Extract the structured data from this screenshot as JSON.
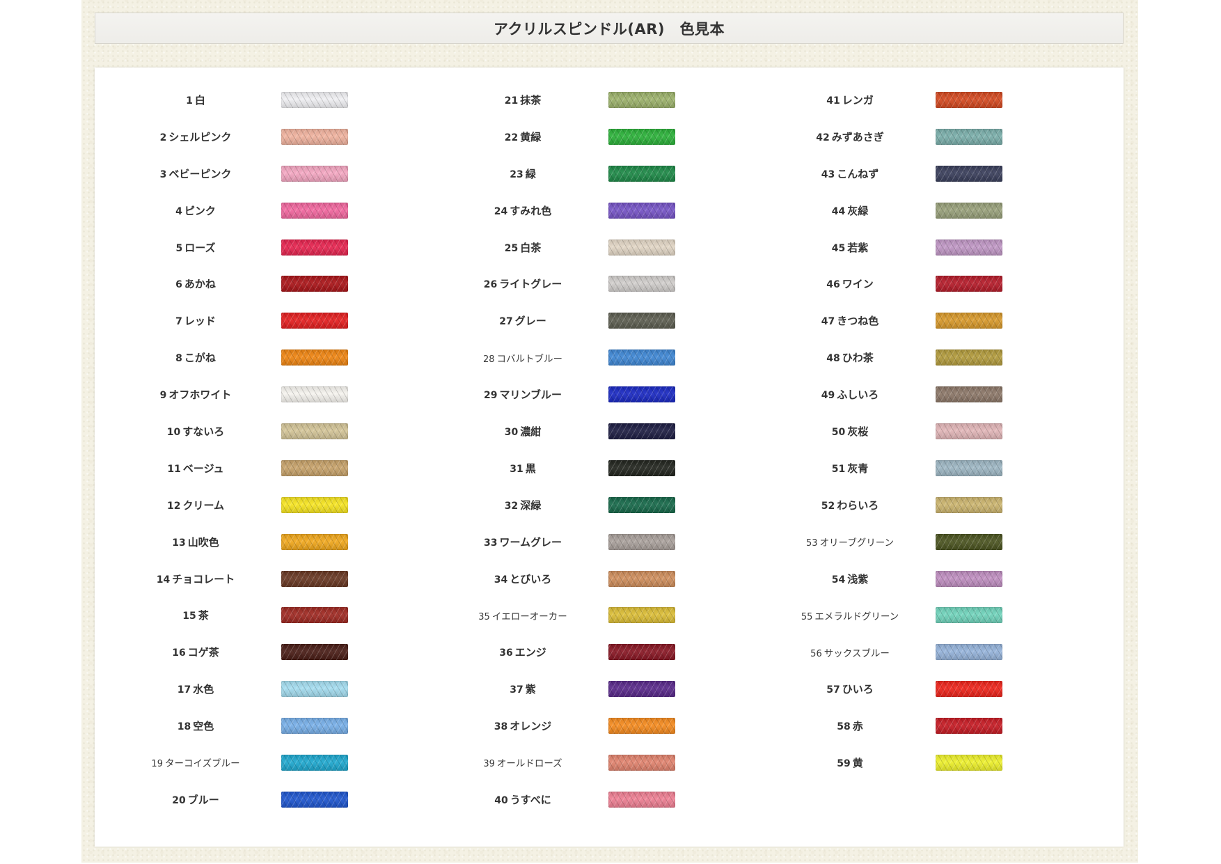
{
  "page": {
    "title": "アクリルスピンドル(AR)　色見本"
  },
  "columns": [
    {
      "items": [
        {
          "no": "1",
          "name": "白",
          "color": "#f0f0f3"
        },
        {
          "no": "2",
          "name": "シェルピンク",
          "color": "#f0b29e"
        },
        {
          "no": "3",
          "name": "ベビーピンク",
          "color": "#f4a6c1"
        },
        {
          "no": "4",
          "name": "ピンク",
          "color": "#f2679f"
        },
        {
          "no": "5",
          "name": "ローズ",
          "color": "#e72550"
        },
        {
          "no": "6",
          "name": "あかね",
          "color": "#ab1519"
        },
        {
          "no": "7",
          "name": "レッド",
          "color": "#e51f20"
        },
        {
          "no": "8",
          "name": "こがね",
          "color": "#ef8512"
        },
        {
          "no": "9",
          "name": "オフホワイト",
          "color": "#f5f3ee"
        },
        {
          "no": "10",
          "name": "すないろ",
          "color": "#d3c497"
        },
        {
          "no": "11",
          "name": "ベージュ",
          "color": "#c7a26a"
        },
        {
          "no": "12",
          "name": "クリーム",
          "color": "#f6e420"
        },
        {
          "no": "13",
          "name": "山吹色",
          "color": "#f1a81d"
        },
        {
          "no": "14",
          "name": "チョコレート",
          "color": "#6a3924"
        },
        {
          "no": "15",
          "name": "茶",
          "color": "#a02a23"
        },
        {
          "no": "16",
          "name": "コゲ茶",
          "color": "#4b1e17"
        },
        {
          "no": "17",
          "name": "水色",
          "color": "#a3dcef"
        },
        {
          "no": "18",
          "name": "空色",
          "color": "#77afe8"
        },
        {
          "no": "19",
          "name": "ターコイズブルー",
          "color": "#1ea8cf"
        },
        {
          "no": "20",
          "name": "ブルー",
          "color": "#1f56cf"
        }
      ]
    },
    {
      "items": [
        {
          "no": "21",
          "name": "抹茶",
          "color": "#9cb26b"
        },
        {
          "no": "22",
          "name": "黄緑",
          "color": "#2cb23a"
        },
        {
          "no": "23",
          "name": "緑",
          "color": "#1e8a48"
        },
        {
          "no": "24",
          "name": "すみれ色",
          "color": "#7654c6"
        },
        {
          "no": "25",
          "name": "白茶",
          "color": "#e1d5c4"
        },
        {
          "no": "26",
          "name": "ライトグレー",
          "color": "#d0cdcb"
        },
        {
          "no": "27",
          "name": "グレー",
          "color": "#5d5e51"
        },
        {
          "no": "28",
          "name": "コバルトブルー",
          "color": "#3f87d4"
        },
        {
          "no": "29",
          "name": "マリンブルー",
          "color": "#1b2ac3"
        },
        {
          "no": "30",
          "name": "濃紺",
          "color": "#1e1e44"
        },
        {
          "no": "31",
          "name": "黒",
          "color": "#23261f"
        },
        {
          "no": "32",
          "name": "深緑",
          "color": "#186a4b"
        },
        {
          "no": "33",
          "name": "ワームグレー",
          "color": "#a9a09b"
        },
        {
          "no": "34",
          "name": "とびいろ",
          "color": "#cf8e5c"
        },
        {
          "no": "35",
          "name": "イエローオーカー",
          "color": "#dbbd36"
        },
        {
          "no": "36",
          "name": "エンジ",
          "color": "#8a1825"
        },
        {
          "no": "37",
          "name": "紫",
          "color": "#5a2a8b"
        },
        {
          "no": "38",
          "name": "オレンジ",
          "color": "#f58b1f"
        },
        {
          "no": "39",
          "name": "オールドローズ",
          "color": "#e1836e"
        },
        {
          "no": "40",
          "name": "うすべに",
          "color": "#ee7f93"
        }
      ]
    },
    {
      "items": [
        {
          "no": "41",
          "name": "レンガ",
          "color": "#d54a21"
        },
        {
          "no": "42",
          "name": "みずあさぎ",
          "color": "#7aaeaa"
        },
        {
          "no": "43",
          "name": "こんねず",
          "color": "#3a3f5c"
        },
        {
          "no": "44",
          "name": "灰緑",
          "color": "#98a07a"
        },
        {
          "no": "45",
          "name": "若紫",
          "color": "#bf96c4"
        },
        {
          "no": "46",
          "name": "ワイン",
          "color": "#b61c2a"
        },
        {
          "no": "47",
          "name": "きつね色",
          "color": "#d8992b"
        },
        {
          "no": "48",
          "name": "ひわ茶",
          "color": "#b29b3d"
        },
        {
          "no": "49",
          "name": "ふしいろ",
          "color": "#8c7768"
        },
        {
          "no": "50",
          "name": "灰桜",
          "color": "#e1b5b7"
        },
        {
          "no": "51",
          "name": "灰青",
          "color": "#9db6c3"
        },
        {
          "no": "52",
          "name": "わらいろ",
          "color": "#cbb46e"
        },
        {
          "no": "53",
          "name": "オリーブグリーン",
          "color": "#4c5521"
        },
        {
          "no": "54",
          "name": "浅紫",
          "color": "#bf8ec0"
        },
        {
          "no": "55",
          "name": "エメラルドグリーン",
          "color": "#70d3bb"
        },
        {
          "no": "56",
          "name": "サックスブルー",
          "color": "#95b3da"
        },
        {
          "no": "57",
          "name": "ひいろ",
          "color": "#ef251c"
        },
        {
          "no": "58",
          "name": "赤",
          "color": "#c71c25"
        },
        {
          "no": "59",
          "name": "黄",
          "color": "#edf02b"
        }
      ]
    }
  ]
}
